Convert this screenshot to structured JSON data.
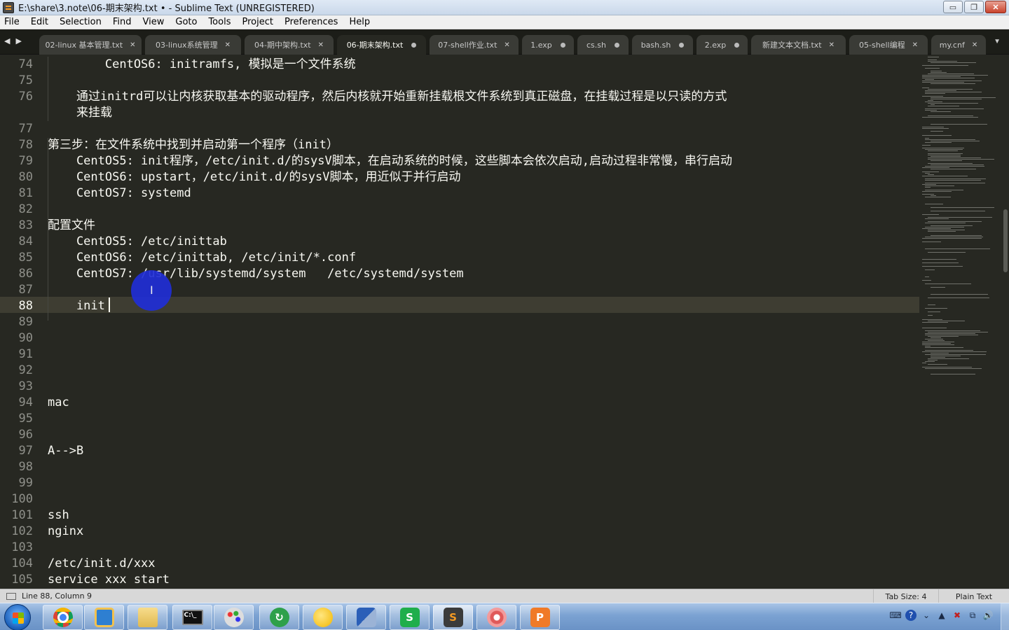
{
  "window": {
    "title": "E:\\share\\3.note\\06-期末架构.txt • - Sublime Text (UNREGISTERED)",
    "minimize_glyph": "▭",
    "restore_glyph": "❐",
    "close_glyph": "✕"
  },
  "menu": [
    "File",
    "Edit",
    "Selection",
    "Find",
    "View",
    "Goto",
    "Tools",
    "Project",
    "Preferences",
    "Help"
  ],
  "tab_nav": {
    "back": "◀",
    "forward": "▶",
    "dropdown": "▼"
  },
  "tabs": [
    {
      "label": "02-linux 基本管理.txt",
      "state": "close"
    },
    {
      "label": "03-linux系统管理",
      "state": "close"
    },
    {
      "label": "04-期中架构.txt",
      "state": "close"
    },
    {
      "label": "06-期末架构.txt",
      "state": "dirty",
      "active": true
    },
    {
      "label": "07-shell作业.txt",
      "state": "close"
    },
    {
      "label": "1.exp",
      "state": "dirty"
    },
    {
      "label": "cs.sh",
      "state": "dirty"
    },
    {
      "label": "bash.sh",
      "state": "dirty"
    },
    {
      "label": "2.exp",
      "state": "dirty"
    },
    {
      "label": "新建文本文档.txt",
      "state": "close"
    },
    {
      "label": "05-shell编程",
      "state": "close"
    },
    {
      "label": "my.cnf",
      "state": "close"
    }
  ],
  "tab_close_glyph": "✕",
  "editor": {
    "current_line": 88,
    "gutter": [
      "74",
      "75",
      "76",
      "",
      "77",
      "78",
      "79",
      "80",
      "81",
      "82",
      "83",
      "84",
      "85",
      "86",
      "87",
      "88",
      "89",
      "90",
      "91",
      "92",
      "93",
      "94",
      "95",
      "96",
      "97",
      "98",
      "99",
      "100",
      "101",
      "102",
      "103",
      "104",
      "105"
    ],
    "lines": [
      "        CentOS6: initramfs, 模拟是一个文件系统",
      "",
      "    通过initrd可以让内核获取基本的驱动程序，然后内核就开始重新挂载根文件系统到真正磁盘，在挂载过程是以只读的方式",
      "    来挂载",
      "",
      "第三步：在文件系统中找到并启动第一个程序（init）",
      "    CentOS5: init程序，/etc/init.d/的sysV脚本，在启动系统的时候，这些脚本会依次启动,启动过程非常慢，串行启动",
      "    CentOS6: upstart，/etc/init.d/的sysV脚本，用近似于并行启动",
      "    CentOS7: systemd",
      "",
      "配置文件",
      "    CentOS5: /etc/inittab",
      "    CentOS6: /etc/inittab, /etc/init/*.conf",
      "    CentOS7: /usr/lib/systemd/system   /etc/systemd/system",
      "",
      "    init",
      "",
      "",
      "",
      "",
      "",
      "mac",
      "",
      "",
      "A-->B",
      "",
      "",
      "",
      "ssh",
      "nginx",
      "",
      "/etc/init.d/xxx",
      "service xxx start"
    ]
  },
  "mouse_pointer_glyph": "I",
  "status": {
    "position": "Line 88, Column 9",
    "tab_size": "Tab Size: 4",
    "syntax": "Plain Text"
  },
  "taskbar": {
    "apps": [
      "chrome",
      "file-manager",
      "folder",
      "terminal",
      "paint",
      "sync",
      "messenger",
      "network-tool",
      "wps-spreadsheet",
      "sublime-text",
      "shell-client",
      "wps-presentation"
    ],
    "app_glyphs": {
      "terminal": "C:\\_",
      "spreadsheet": "S",
      "sublime": "S",
      "presentation": "P"
    },
    "tray_glyphs": [
      "⌨",
      "?",
      "⌄",
      "▲",
      "✖",
      "⧉",
      "🔊"
    ]
  },
  "colors": {
    "editor_bg": "#272822",
    "text": "#f8f8f2",
    "gutter_text": "#8f908a",
    "current_line": "#3e3d32",
    "cursor_halo": "#1f2ed6"
  }
}
